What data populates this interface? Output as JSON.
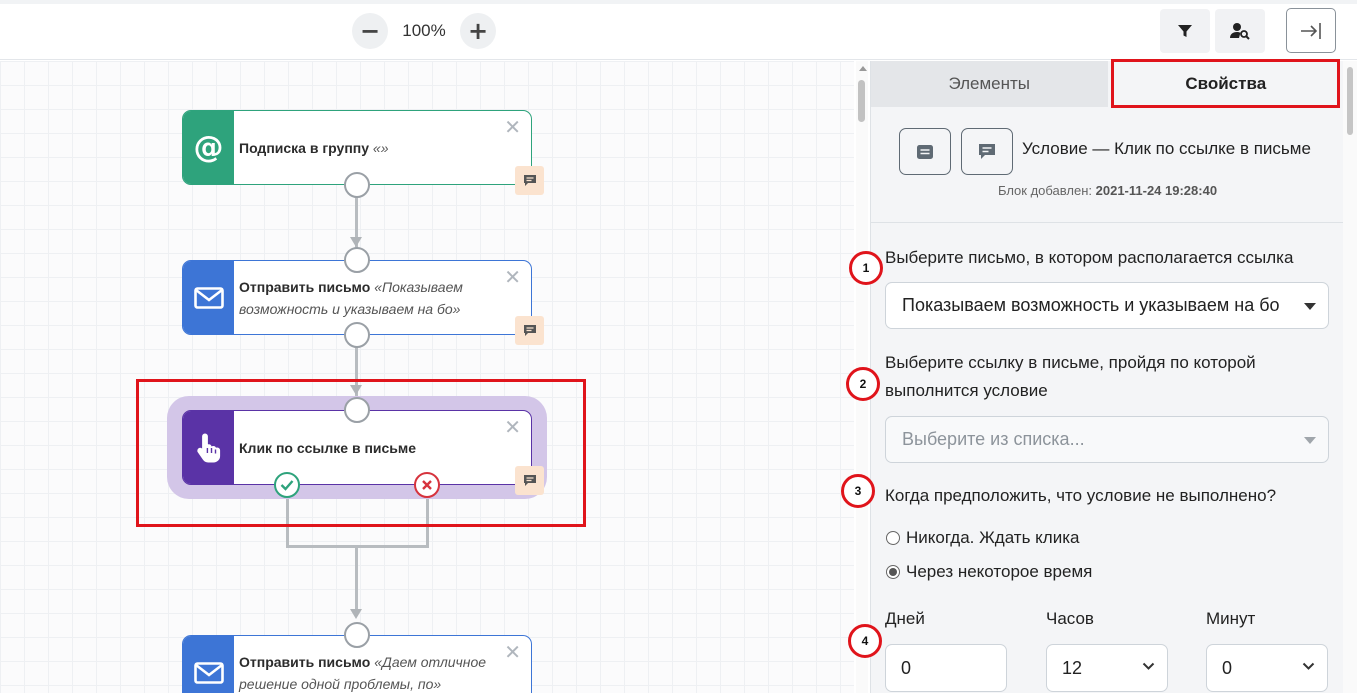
{
  "toolbar": {
    "zoom_minus": "−",
    "zoom_level": "100%",
    "zoom_plus": "+",
    "filter_icon": "filter-icon",
    "user_search_icon": "user-search-icon",
    "exit_icon": "arrow-to-right-icon"
  },
  "canvas": {
    "nodes": [
      {
        "title": "Подписка в группу",
        "subtitle": "«»",
        "icon": "at-sign-icon",
        "color": "#2ea37c"
      },
      {
        "title": "Отправить письмо",
        "subtitle": "«Показываем возможность и указываем на бо»",
        "icon": "envelope-icon",
        "color": "#3d75d6"
      },
      {
        "title": "Клик по ссылке в письме",
        "subtitle": "",
        "icon": "hand-pointer-icon",
        "color": "#5a33a6"
      },
      {
        "title": "Отправить письмо",
        "subtitle": "«Даем отличное решение одной проблемы, по»",
        "icon": "envelope-icon",
        "color": "#3d75d6"
      }
    ],
    "close_glyph": "✕"
  },
  "panel": {
    "tabs": [
      "Элементы",
      "Свойства"
    ],
    "active_tab": "Свойства",
    "block_title": "Условие — Клик по ссылке в письме",
    "block_added_label": "Блок добавлен:",
    "block_added_date": "2021-11-24 19:28:40",
    "steps": [
      "1",
      "2",
      "3",
      "4"
    ],
    "letter_label": "Выберите письмо, в котором располагается ссылка",
    "letter_value": "Показываем возможность и указываем на бо",
    "link_label_line1": "Выберите ссылку в письме, пройдя по которой",
    "link_label_line2": "выполнится условие",
    "link_placeholder": "Выберите из списка...",
    "condition_label": "Когда предположить, что условие не выполнено?",
    "radio_never": "Никогда. Ждать клика",
    "radio_after": "Через некоторое время",
    "days_label": "Дней",
    "hours_label": "Часов",
    "minutes_label": "Минут",
    "days_value": "0",
    "hours_value": "12",
    "minutes_value": "0"
  },
  "colors": {
    "accent_red": "#e0141b",
    "green": "#2ea37c",
    "blue": "#3d75d6",
    "purple": "#5a33a6",
    "note_bg": "#fbe3cf"
  }
}
